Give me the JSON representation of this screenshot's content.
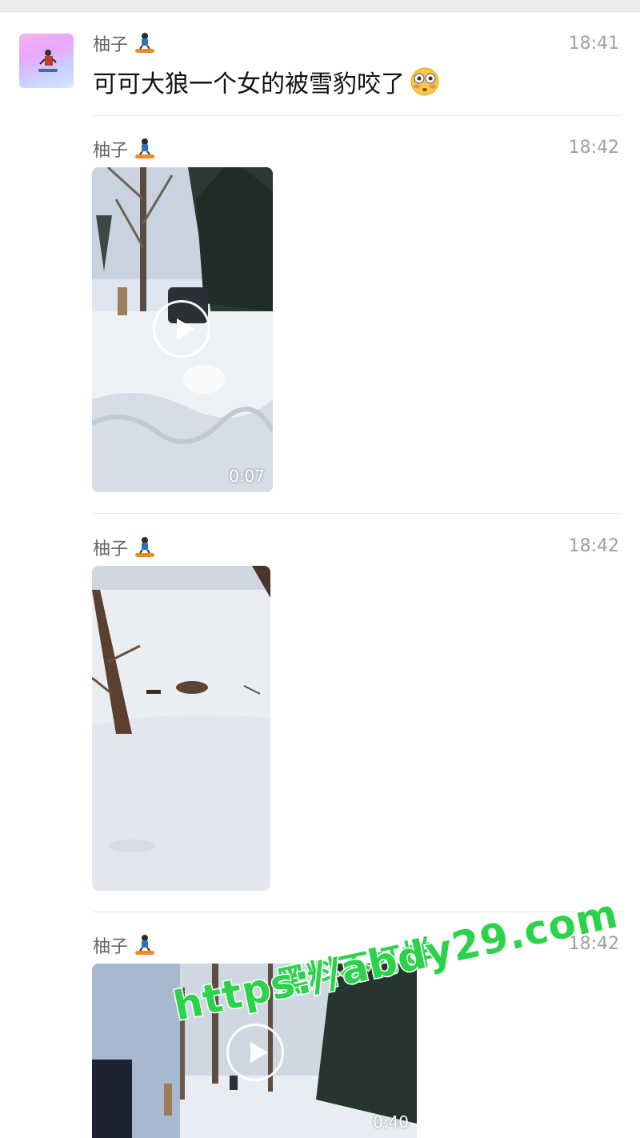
{
  "messages": [
    {
      "sender": "柚子",
      "time": "18:41",
      "text": "可可大狼一个女的被雪豹咬了"
    },
    {
      "sender": "柚子",
      "time": "18:42",
      "video_duration": "0:07"
    },
    {
      "sender": "柚子",
      "time": "18:42"
    },
    {
      "sender": "柚子",
      "time": "18:42",
      "video_duration": "0:40"
    }
  ],
  "icons": {
    "sender_emoji": "snowboarder-icon",
    "flushed_emoji": "flushed-face-icon",
    "play": "play-icon"
  },
  "watermark": {
    "line1": "黑料不打烊",
    "line2": "https://abdy29.com"
  },
  "colors": {
    "watermark": "#2bd34a",
    "time": "#a0a0a0",
    "sender": "#666666"
  }
}
